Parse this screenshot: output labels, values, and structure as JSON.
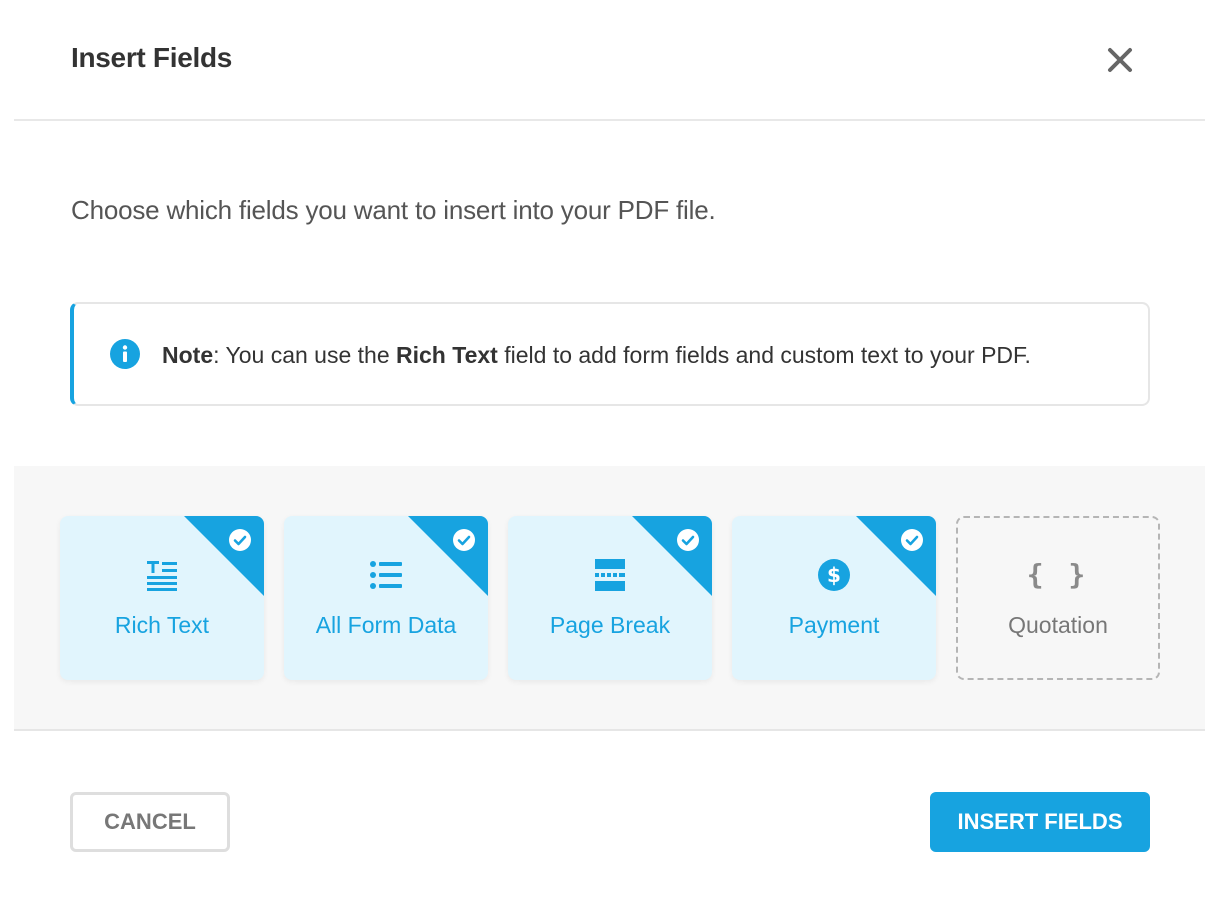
{
  "dialog": {
    "title": "Insert Fields",
    "close_icon": "close-icon",
    "intro": "Choose which fields you want to insert into your PDF file."
  },
  "note": {
    "icon": "info-icon",
    "label": "Note",
    "text_before": ": You can use the ",
    "highlight": "Rich Text",
    "text_after": " field to add form fields and custom text to your PDF."
  },
  "fields": [
    {
      "label": "Rich Text",
      "icon": "rich-text-icon",
      "selected": true
    },
    {
      "label": "All Form Data",
      "icon": "list-icon",
      "selected": true
    },
    {
      "label": "Page Break",
      "icon": "page-break-icon",
      "selected": true
    },
    {
      "label": "Payment",
      "icon": "dollar-icon",
      "selected": true
    },
    {
      "label": "Quotation",
      "icon": "curly-braces-icon",
      "glyph": "{ }",
      "selected": false
    }
  ],
  "footer": {
    "cancel_label": "CANCEL",
    "insert_label": "INSERT FIELDS"
  },
  "colors": {
    "accent": "#17a3e0",
    "selected_card_bg": "#e1f5fd",
    "area_bg": "#f7f7f7"
  }
}
